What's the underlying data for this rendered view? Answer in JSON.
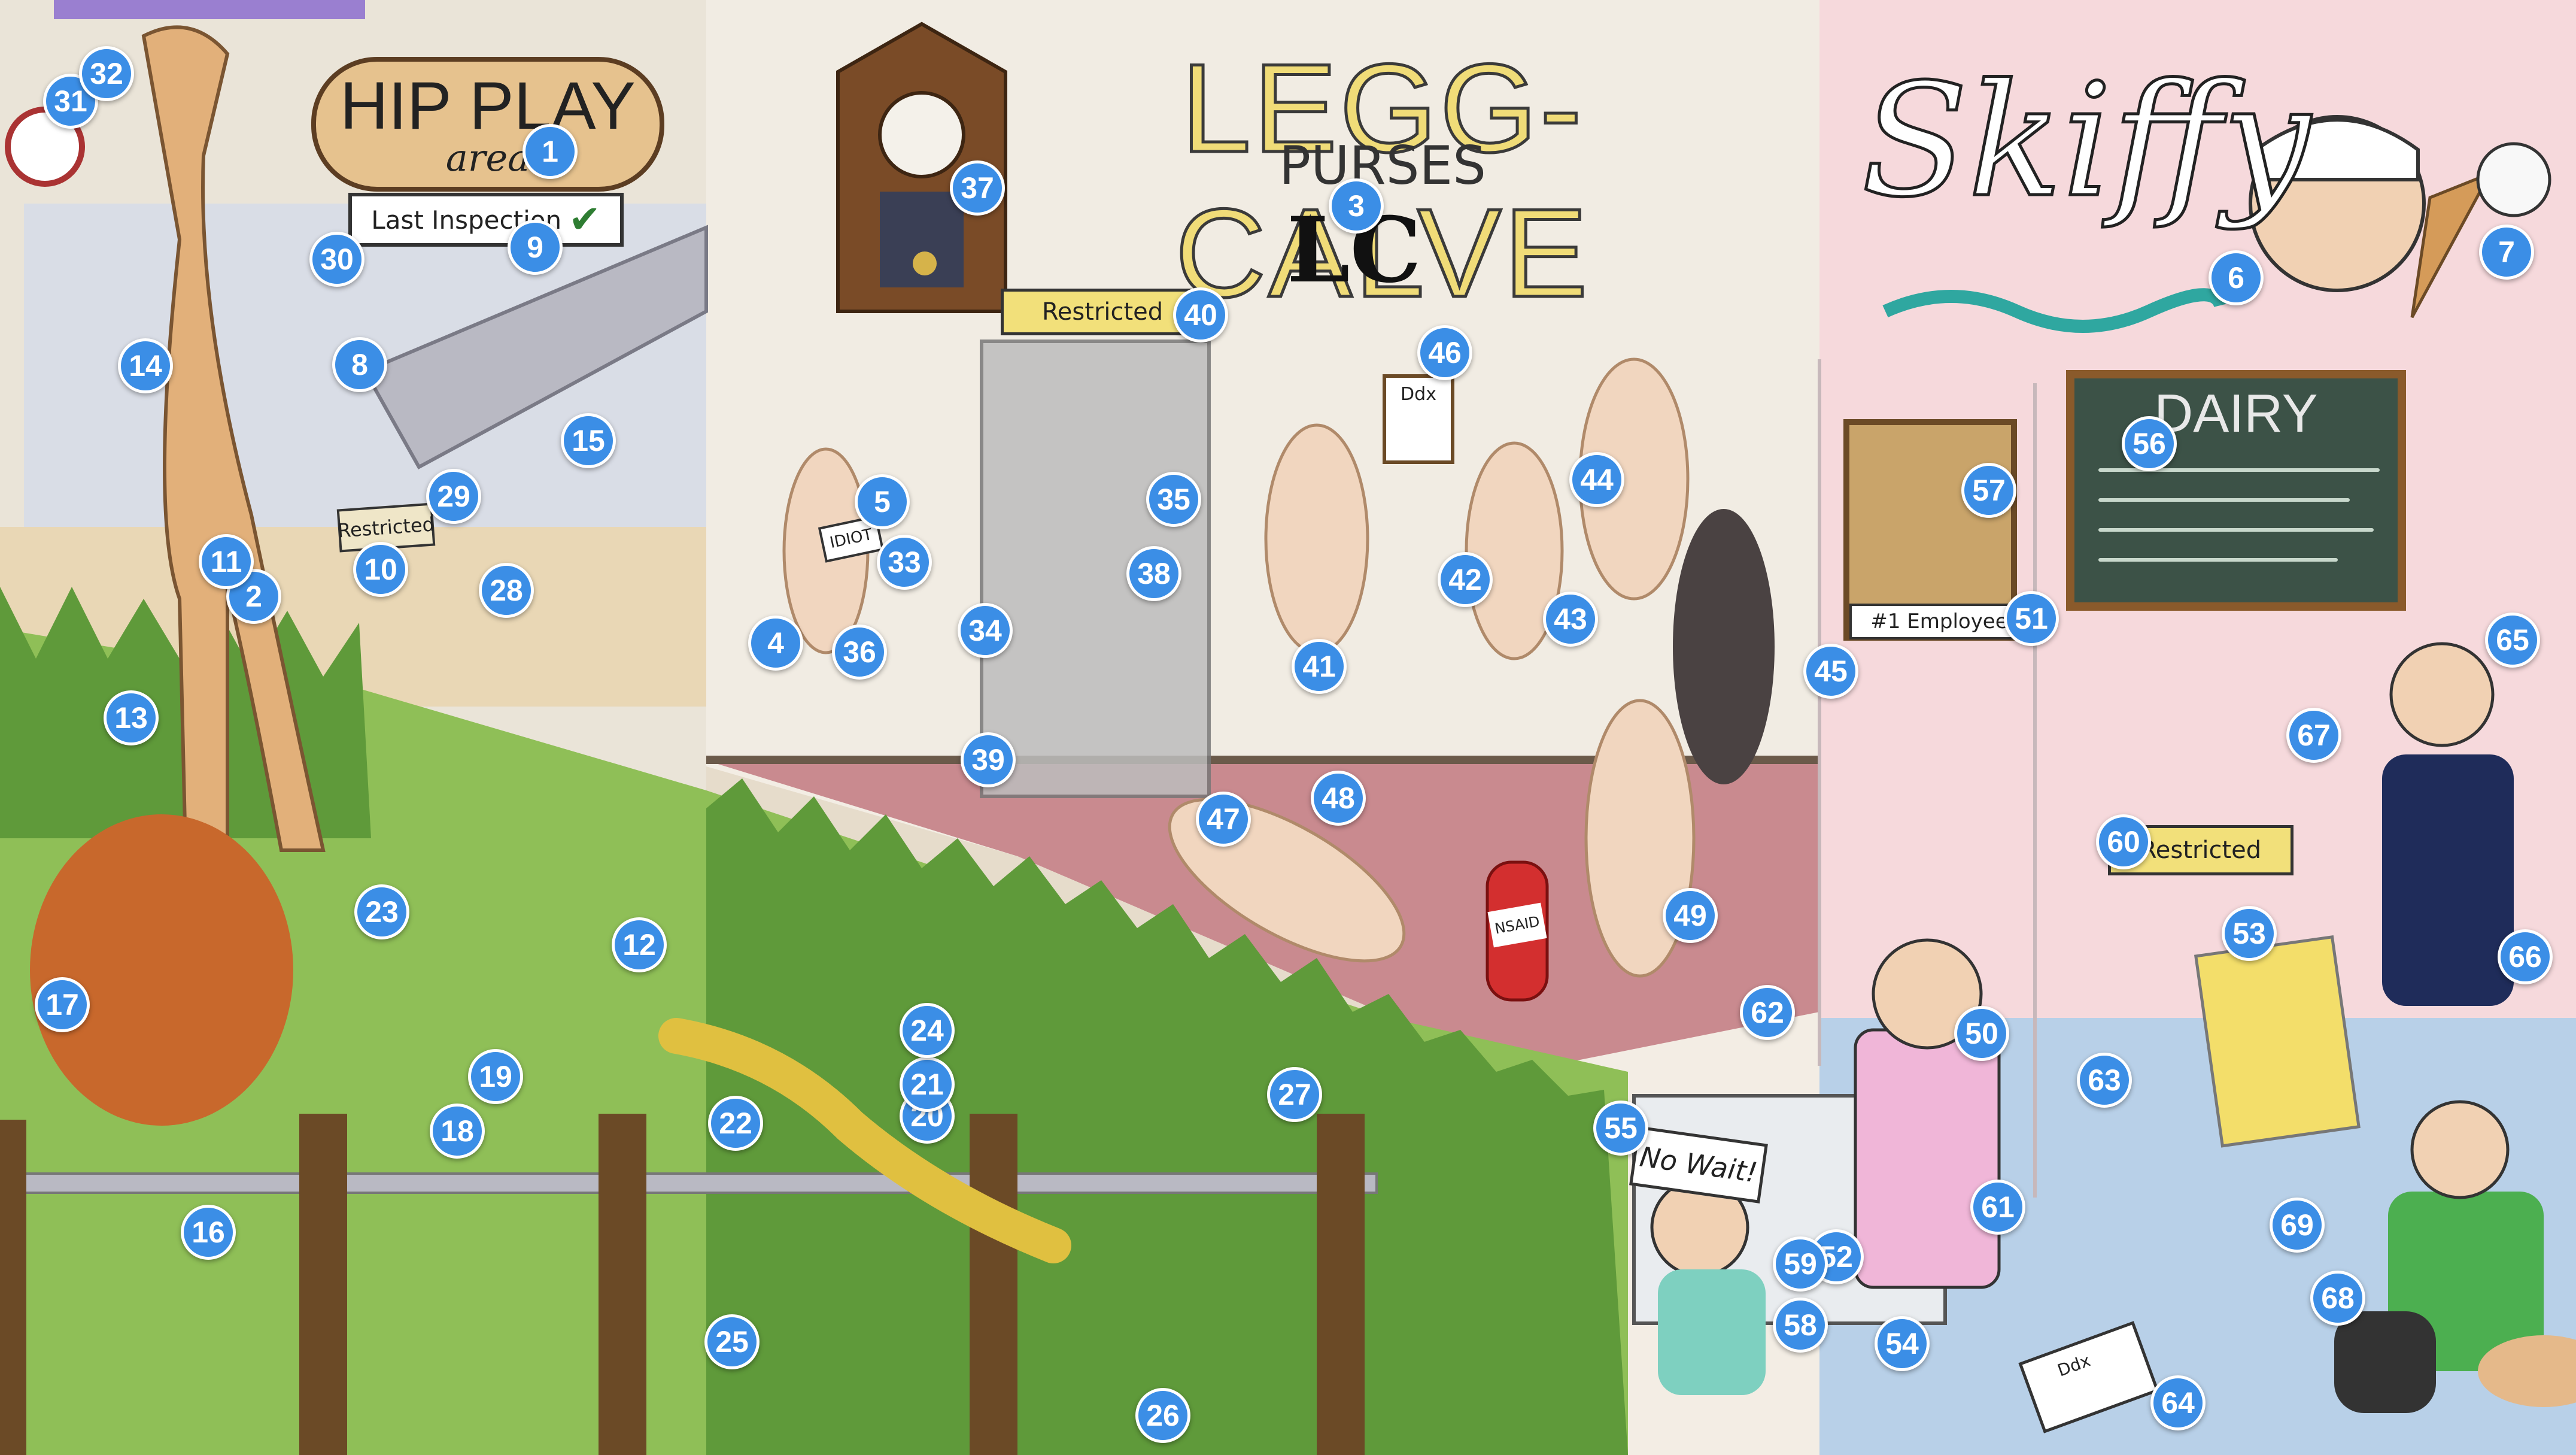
{
  "signs": {
    "hip_play_title": "HIP PLAY",
    "hip_play_sub": "area",
    "last_inspection": "Last Inspection",
    "restricted_giraffe": "Restricted",
    "legg_calve": "LEGG-CALVE",
    "purses": "PURSES",
    "lc_logo": "LC",
    "restricted_door": "Restricted",
    "ddx_clipboard": "Ddx",
    "skiffy": "Skiffy",
    "dairy": "DAIRY",
    "employee_plaque": "#1 Employee",
    "restricted_freezer": "Restricted",
    "no_wait": "No Wait!",
    "nsaid": "NSAID",
    "ddx_floor": "Ddx",
    "idiot_tag": "IDIOT"
  },
  "markers": [
    "1",
    "2",
    "3",
    "4",
    "5",
    "6",
    "7",
    "8",
    "9",
    "10",
    "11",
    "12",
    "13",
    "14",
    "15",
    "16",
    "17",
    "18",
    "19",
    "20",
    "21",
    "22",
    "23",
    "24",
    "25",
    "26",
    "27",
    "28",
    "29",
    "30",
    "31",
    "32",
    "33",
    "34",
    "35",
    "36",
    "37",
    "38",
    "39",
    "40",
    "41",
    "42",
    "43",
    "44",
    "45",
    "46",
    "47",
    "48",
    "49",
    "50",
    "51",
    "52",
    "53",
    "54",
    "55",
    "56",
    "57",
    "58",
    "59",
    "60",
    "61",
    "62",
    "63",
    "64",
    "65",
    "66",
    "67",
    "68",
    "69"
  ],
  "colors": {
    "marker": "#3b8ee6",
    "grass": "#8fbf57",
    "wall_left": "#f3ede4",
    "wall_right": "#f6d9dc",
    "purse_floor": "#c98a8f",
    "sign_yellow": "#f2e07a"
  }
}
